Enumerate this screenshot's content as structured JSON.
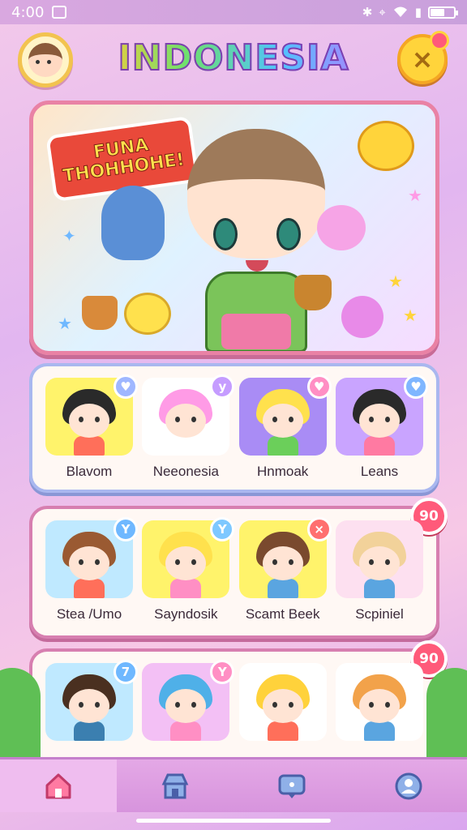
{
  "status_bar": {
    "time": "4:00",
    "battery_level": 0.6
  },
  "header": {
    "title": "INDONESIA",
    "profile_icon": "avatar-icon",
    "close_icon": "close-x-icon"
  },
  "hero": {
    "banner_line1": "FUNA",
    "banner_line2": "THOHHOHE!"
  },
  "rows": [
    {
      "badge": "",
      "cards": [
        {
          "label": "Blavom",
          "hair": "#2a2a2a",
          "tile": "#fff36b",
          "outfit": "#ff6f5a",
          "badge_color": "#9fb7ff",
          "badge_icon": "heart-icon",
          "badge_glyph": "♥"
        },
        {
          "label": "Neeonesia",
          "hair": "#ff9be6",
          "tile": "#ffffff",
          "outfit": "#ffffff",
          "badge_color": "#c59cff",
          "badge_icon": "check-icon",
          "badge_glyph": "y"
        },
        {
          "label": "Hnmoak",
          "hair": "#ffe14d",
          "tile": "#a98cf5",
          "outfit": "#6bcf5a",
          "badge_color": "#ff8fc4",
          "badge_icon": "heart-icon",
          "badge_glyph": "♥"
        },
        {
          "label": "Leans",
          "hair": "#2a2a2a",
          "tile": "#c9a4ff",
          "outfit": "#ff7aa2",
          "badge_color": "#7fb6ff",
          "badge_icon": "heart-icon",
          "badge_glyph": "♥"
        }
      ]
    },
    {
      "badge": "90",
      "cards": [
        {
          "label": "Stea /Umo",
          "hair": "#9a5a32",
          "tile": "#bfe9ff",
          "outfit": "#ff6f5a",
          "badge_color": "#6fb8ff",
          "badge_icon": "check-icon",
          "badge_glyph": "Y"
        },
        {
          "label": "Sayndosik",
          "hair": "#ffe14d",
          "tile": "#fff36b",
          "outfit": "#ff8fc4",
          "badge_color": "#7ec8ff",
          "badge_icon": "check-icon",
          "badge_glyph": "Y"
        },
        {
          "label": "Scamt Beek",
          "hair": "#7a4a2e",
          "tile": "#fff36b",
          "outfit": "#5aa5e0",
          "badge_color": "#ff6f6f",
          "badge_icon": "close-icon",
          "badge_glyph": "×"
        },
        {
          "label": "Scpiniel",
          "hair": "#f2d29a",
          "tile": "#fde0f0",
          "outfit": "#5aa5e0",
          "badge_color": "",
          "badge_icon": "",
          "badge_glyph": ""
        }
      ]
    },
    {
      "badge": "90",
      "cards": [
        {
          "label": "",
          "hair": "#4a3020",
          "tile": "#bfe9ff",
          "outfit": "#3b7fb0",
          "badge_color": "#6fb8ff",
          "badge_icon": "number-icon",
          "badge_glyph": "7"
        },
        {
          "label": "",
          "hair": "#4fb0e8",
          "tile": "#f3c0f5",
          "outfit": "#ff8fc4",
          "badge_color": "#ff8fc4",
          "badge_icon": "check-icon",
          "badge_glyph": "Y"
        },
        {
          "label": "",
          "hair": "#ffd23b",
          "tile": "#ffffff",
          "outfit": "#ff6f5a",
          "badge_color": "",
          "badge_icon": "",
          "badge_glyph": ""
        },
        {
          "label": "",
          "hair": "#f2a24a",
          "tile": "#ffffff",
          "outfit": "#5aa5e0",
          "badge_color": "",
          "badge_icon": "",
          "badge_glyph": ""
        }
      ]
    }
  ],
  "bottom_nav": [
    {
      "icon": "home-icon",
      "active": true
    },
    {
      "icon": "shop-icon",
      "active": false
    },
    {
      "icon": "chat-icon",
      "active": false
    },
    {
      "icon": "profile-icon",
      "active": false
    }
  ],
  "colors": {
    "accent_pink": "#e982a5",
    "badge_red": "#ff5a7a",
    "nav_bg": "#d794dd",
    "title_outline": "#7d3fb0"
  }
}
